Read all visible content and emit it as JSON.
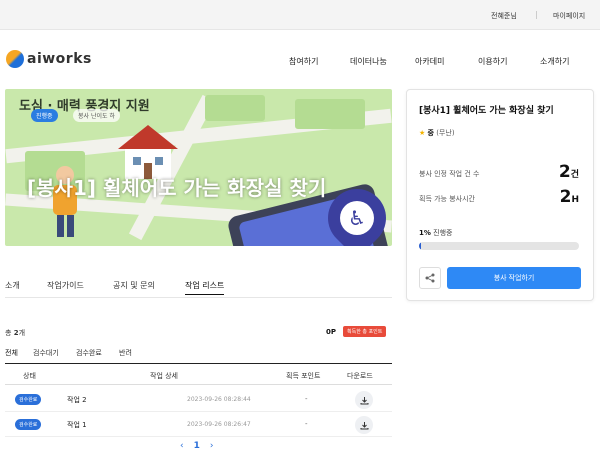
{
  "topbar": {
    "user": "전혜준님",
    "mypage": "마이페이지"
  },
  "logo": {
    "text": "aiworks"
  },
  "nav": [
    "참여하기",
    "데이터나눔",
    "아카데미",
    "이용하기",
    "소개하기"
  ],
  "banner": {
    "deco_text": "도심 · 매력 풍경지 지원",
    "badge_progress": "진행중",
    "badge_level": "봉사 난이도 하",
    "title": "[봉사1] 휠체어도 가는 화장실 찾기"
  },
  "card": {
    "title": "[봉사1] 휠체어도 가는 화장실 찾기",
    "level_label": "중",
    "level_note": "(무난)",
    "rows": [
      {
        "label": "봉사 인정 작업 건 수",
        "value": "2",
        "unit": "건"
      },
      {
        "label": "획득 가능 봉사시간",
        "value": "2",
        "unit": "H"
      }
    ],
    "progress_percent": "1%",
    "progress_text": "진행중",
    "progress_fraction": 0.01,
    "apply_label": "봉사 작업하기"
  },
  "tabs": [
    "소개",
    "작업가이드",
    "공지 및 문의",
    "작업 리스트"
  ],
  "list": {
    "total_prefix": "총",
    "total_count": "2",
    "total_suffix": "개",
    "points": "0P",
    "points_badge": "획득한 총 포인트",
    "filters": [
      "전체",
      "검수대기",
      "검수완료",
      "반려"
    ],
    "headers": [
      "상태",
      "작업 상세",
      "획득 포인트",
      "다운로드"
    ],
    "rows": [
      {
        "status": "검수완료",
        "name": "작업 2",
        "date": "2023-09-26 08:28:44",
        "point": "-"
      },
      {
        "status": "검수완료",
        "name": "작업 1",
        "date": "2023-09-26 08:26:47",
        "point": "-"
      }
    ]
  },
  "pager": {
    "prev": "‹",
    "page": "1",
    "next": "›"
  },
  "colors": {
    "accent": "#2e89f5",
    "danger": "#e84b3a",
    "progress": "#2a5fd0"
  }
}
